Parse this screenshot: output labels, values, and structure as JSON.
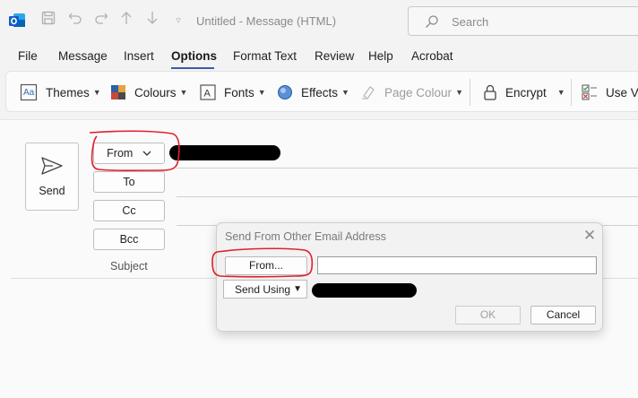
{
  "window": {
    "title": "Untitled  -  Message (HTML)",
    "search_placeholder": "Search"
  },
  "menu": [
    "File",
    "Message",
    "Insert",
    "Options",
    "Format Text",
    "Review",
    "Help",
    "Acrobat"
  ],
  "menu_active": "Options",
  "ribbon": {
    "themes": "Themes",
    "colours": "Colours",
    "fonts": "Fonts",
    "effects": "Effects",
    "page_colour": "Page Colour",
    "encrypt": "Encrypt",
    "use_voting": "Use Vo"
  },
  "compose": {
    "send": "Send",
    "from": "From",
    "to": "To",
    "cc": "Cc",
    "bcc": "Bcc",
    "subject": "Subject"
  },
  "dialog": {
    "title": "Send From Other Email Address",
    "from_button": "From...",
    "send_using": "Send Using",
    "ok": "OK",
    "cancel": "Cancel"
  },
  "colors": {
    "accent": "#3b5ca8",
    "annotation": "#e2202a"
  },
  "icons": {
    "app": "outlook-icon",
    "save": "save-icon",
    "undo": "undo-icon",
    "redo": "redo-icon",
    "up": "arrow-up-icon",
    "down": "arrow-down-icon",
    "search": "search-icon",
    "send": "send-icon",
    "close": "close-icon"
  }
}
